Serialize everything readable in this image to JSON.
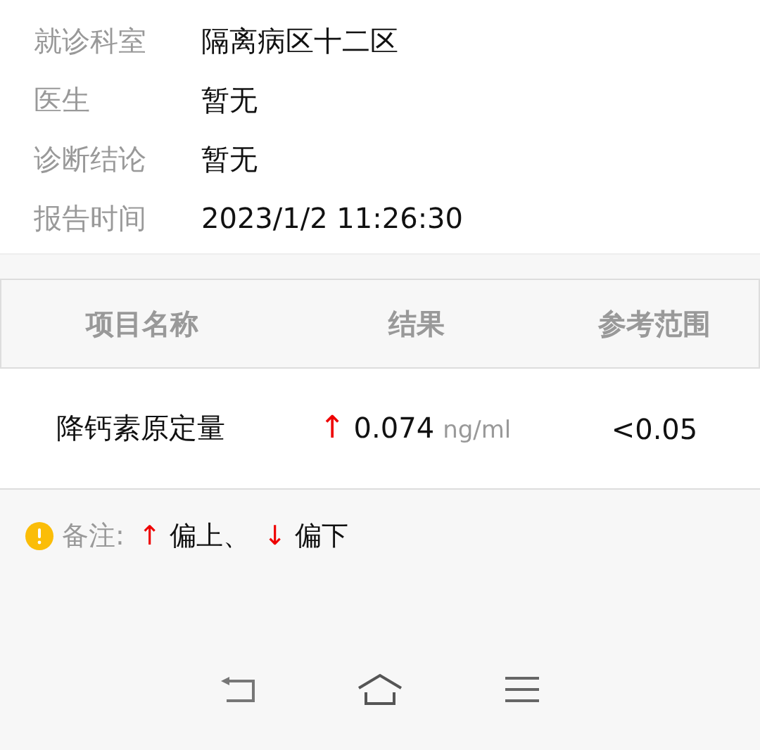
{
  "info": [
    {
      "label": "就诊科室",
      "value": "隔离病区十二区"
    },
    {
      "label": "医生",
      "value": "暂无"
    },
    {
      "label": "诊断结论",
      "value": "暂无"
    },
    {
      "label": "报告时间",
      "value": "2023/1/2 11:26:30"
    }
  ],
  "table": {
    "columns": [
      "项目名称",
      "结果",
      "参考范围"
    ],
    "rows": [
      {
        "name": "降钙素原定量",
        "flag": "↑",
        "value": "0.074",
        "unit": "ng/ml",
        "range": "<0.05"
      }
    ]
  },
  "note": {
    "label": "备注:",
    "items": [
      {
        "arrow": "↑",
        "text": "偏上、"
      },
      {
        "arrow": "↓",
        "text": "偏下"
      }
    ]
  }
}
